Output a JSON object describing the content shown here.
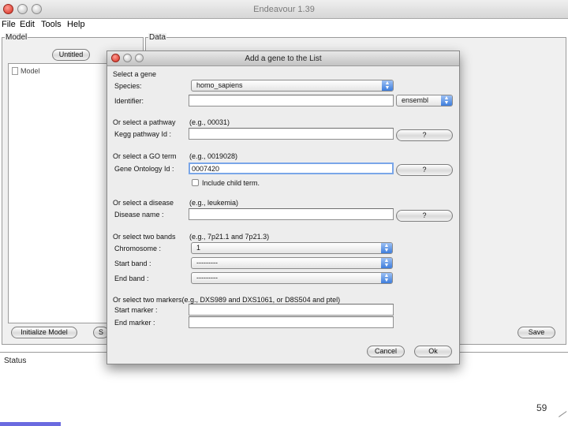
{
  "window": {
    "title": "Endeavour 1.39"
  },
  "menu": {
    "file": "File",
    "edit": "Edit",
    "tools": "Tools",
    "help": "Help"
  },
  "model_panel": {
    "label": "Model",
    "tab_label": "Untitled",
    "tree_item": "Model",
    "initialize_button": "Initialize Model",
    "truncated_button": "S"
  },
  "data_panel": {
    "label": "Data",
    "save_button": "Save"
  },
  "status": {
    "label": "Status"
  },
  "page_number": "59",
  "dialog": {
    "title": "Add a gene to the List",
    "gene": {
      "section": "Select a gene",
      "species_label": "Species:",
      "species_value": "homo_sapiens",
      "identifier_label": "Identifier:",
      "identifier_value": "",
      "source_value": "ensembl"
    },
    "pathway": {
      "section": "Or select a pathway",
      "hint": "(e.g., 00031)",
      "label": "Kegg pathway Id :",
      "value": "",
      "help_button": "?"
    },
    "go": {
      "section": "Or select a GO term",
      "hint": "(e.g., 0019028)",
      "label": "Gene Ontology Id :",
      "value": "0007420",
      "help_button": "?",
      "checkbox_label": "Include child term."
    },
    "disease": {
      "section": "Or select a disease",
      "hint": "(e.g., leukemia)",
      "label": "Disease name :",
      "value": "",
      "help_button": "?"
    },
    "bands": {
      "section": "Or select two bands",
      "hint": "(e.g., 7p21.1 and 7p21.3)",
      "chromosome_label": "Chromosome :",
      "chromosome_value": "1",
      "start_label": "Start band :",
      "start_value": "---------",
      "end_label": "End band :",
      "end_value": "---------"
    },
    "markers": {
      "section": "Or select two markers(e.g., DXS989 and DXS1061, or D8S504 and ptel)",
      "start_label": "Start marker :",
      "start_value": "",
      "end_label": "End marker :",
      "end_value": ""
    },
    "cancel_button": "Cancel",
    "ok_button": "Ok"
  },
  "colors": {
    "focus_ring": "#7aa6e8",
    "popup_arrow": "#3d7ddc",
    "slide_bar": "#6a6ae0"
  }
}
